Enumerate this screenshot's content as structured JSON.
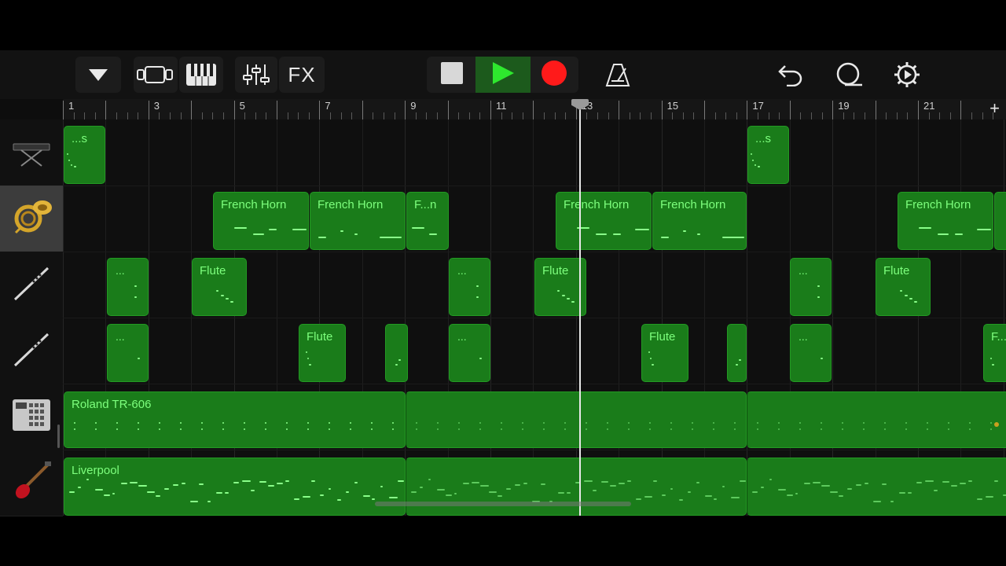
{
  "toolbar": {
    "browser_icon": "triangle-down-icon",
    "tracks_view_icon": "tracks-view-icon",
    "keyboard_icon": "piano-keys-icon",
    "mixer_icon": "mixer-sliders-icon",
    "fx_label": "FX",
    "stop_icon": "stop-icon",
    "play_icon": "play-icon",
    "record_icon": "record-icon",
    "metronome_icon": "metronome-icon",
    "undo_icon": "undo-icon",
    "loop_browser_icon": "loop-icon",
    "settings_icon": "gear-icon"
  },
  "ruler": {
    "bar_labels": [
      "1",
      "3",
      "5",
      "7",
      "9",
      "11",
      "13",
      "15",
      "17",
      "19",
      "21"
    ],
    "add_label": "+"
  },
  "tracks": [
    {
      "instrument": "Keyboard",
      "icon": "keyboard-stand-icon",
      "selected": false
    },
    {
      "instrument": "French Horn",
      "icon": "french-horn-icon",
      "selected": true
    },
    {
      "instrument": "Flute",
      "icon": "flute-icon",
      "selected": false
    },
    {
      "instrument": "Flute",
      "icon": "flute-icon",
      "selected": false
    },
    {
      "instrument": "Drum Machine",
      "icon": "drum-machine-icon",
      "selected": false
    },
    {
      "instrument": "Bass",
      "icon": "bass-guitar-icon",
      "selected": false
    }
  ],
  "regions": {
    "keys_1": "...s",
    "keys_2": "...s",
    "horn_1": "French Horn",
    "horn_2": "French Horn",
    "horn_3": "F...n",
    "horn_4": "French Horn",
    "horn_5": "French Horn",
    "horn_6": "French Horn",
    "flute_a1": "...",
    "flute_a2": "Flute",
    "flute_a3": "...",
    "flute_a4": "Flute",
    "flute_a5": "...",
    "flute_a6": "Flute",
    "flute_b1": "...",
    "flute_b2": "Flute",
    "flute_b3": "...",
    "flute_b4": "Flute",
    "flute_b5": "...",
    "flute_b6": "F...",
    "drums": "Roland TR-606",
    "bass": "Liverpool"
  },
  "colors": {
    "region_fill": "#1a7c1a",
    "region_label": "#7dff7d",
    "record": "#ff1a1a",
    "play": "#2ee82e"
  }
}
